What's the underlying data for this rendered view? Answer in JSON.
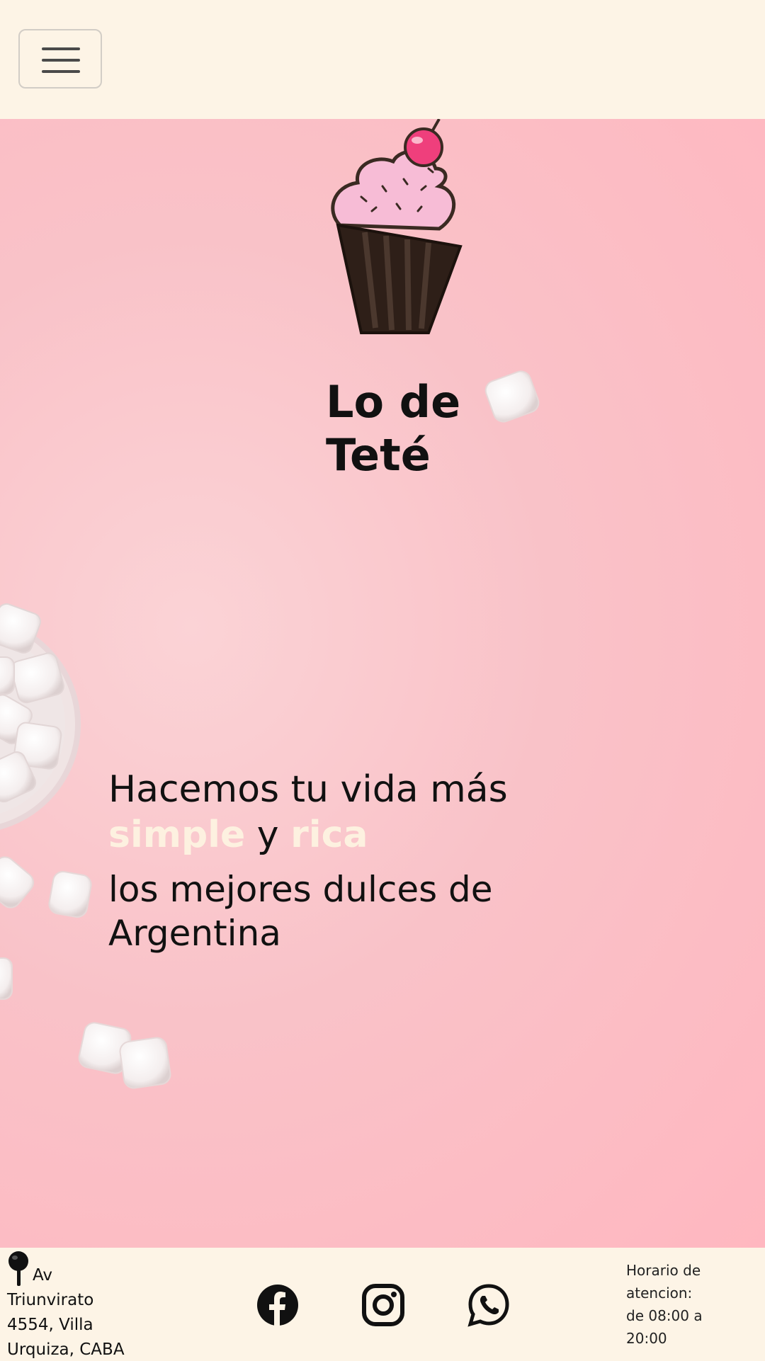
{
  "navbar": {
    "menu_button_icon": "hamburger-menu-icon"
  },
  "hero": {
    "logo_icon": "cupcake-logo",
    "brand_line1": "Lo de",
    "brand_line2": "Teté",
    "tagline_line1": "Hacemos tu vida más",
    "tagline_word_simple": "simple",
    "tagline_word_y": " y ",
    "tagline_word_rica": "rica",
    "subtitle_line1": "los mejores dulces de",
    "subtitle_line2": "Argentina",
    "colors": {
      "background": "#f9c2c8",
      "accent_text": "#fdf1e0"
    }
  },
  "footer": {
    "address_icon": "map-pin-icon",
    "address_line1": "Av",
    "address_line2": "Triunvirato",
    "address_line3": "4554, Villa",
    "address_line4": "Urquiza, CABA",
    "social_icons": [
      "facebook-icon",
      "instagram-icon",
      "whatsapp-icon"
    ],
    "hours_line1": "Horario de",
    "hours_line2": "atencion:",
    "hours_line3": "de 08:00 a",
    "hours_line4": "20:00",
    "colors": {
      "background": "#fdf4e6"
    }
  }
}
